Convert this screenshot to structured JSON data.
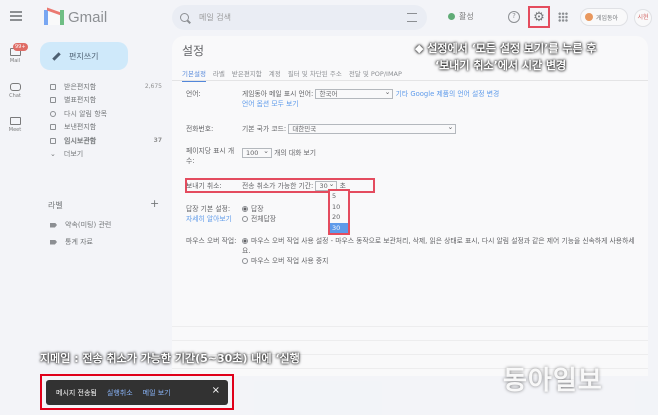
{
  "app": {
    "name": "Gmail"
  },
  "search": {
    "placeholder": "메일 검색"
  },
  "status": {
    "label": "활성"
  },
  "org": {
    "label": "게임동아"
  },
  "avatar": {
    "initials": "시현"
  },
  "rail": {
    "mail": "Mail",
    "mail_badge": "99+",
    "chat": "Chat",
    "meet": "Meet"
  },
  "compose": {
    "label": "편지쓰기"
  },
  "nav": {
    "items": [
      {
        "label": "받은편지함",
        "count": "2,675"
      },
      {
        "label": "별표편지함",
        "count": ""
      },
      {
        "label": "다시 알림 항목",
        "count": ""
      },
      {
        "label": "보낸편지함",
        "count": ""
      },
      {
        "label": "임시보관함",
        "count": "37"
      },
      {
        "label": "더보기",
        "count": ""
      }
    ]
  },
  "labels": {
    "heading": "라벨",
    "items": [
      "약속(미팅) 관련",
      "통계 자료"
    ]
  },
  "settings": {
    "title": "설정",
    "tabs": [
      "기본설정",
      "라벨",
      "받은편지함",
      "계정",
      "필터 및 차단된 주소",
      "전달 및 POP/IMAP"
    ],
    "language": {
      "label": "언어:",
      "text": "게임동아 메일 표시 언어:",
      "value": "한국어",
      "link": "기타 Google 제품의 언어 설정 변경",
      "link2": "언어 옵션 모두 보기"
    },
    "phone": {
      "label": "전화번호:",
      "text": "기본 국가 코드:",
      "value": "대한민국"
    },
    "page_size": {
      "label": "페이지당 표시 개수:",
      "value": "100",
      "suffix": "개의 대화 보기"
    },
    "undo_send": {
      "label": "보내기 취소:",
      "text": "전송 취소가 가능한 기간:",
      "value": "30",
      "unit": "초",
      "options": [
        "5",
        "10",
        "20",
        "30"
      ]
    },
    "reply": {
      "label": "답장 기본 설정:",
      "link": "자세히 알아보기",
      "opt1": "답장",
      "opt2": "전체답장"
    },
    "hover": {
      "label": "마우스 오버 작업:",
      "opt1": "마우스 오버 작업 사용 설정",
      "opt1_desc": " - 마우스 동작으로 보관처리, 삭제, 읽은 상태로 표시, 다시 알림 설정과 같은 제어 기능을 신속하게 사용하세요.",
      "opt2": "마우스 오버 작업 사용 중지"
    }
  },
  "callout": {
    "line1": "◆ 설정에서 ‘모든 설정 보기’를 누른 후",
    "line2": "‘보내기 취소’에서 시간 변경"
  },
  "caption": {
    "text": "지메일 : 전송 취소가 가능한 기간(5~30초) 내에 ‘실행"
  },
  "toast": {
    "message": "메시지 전송됨",
    "undo": "실행취소",
    "view": "메일 보기",
    "close": "×"
  },
  "watermark": {
    "text": "동아일보"
  }
}
